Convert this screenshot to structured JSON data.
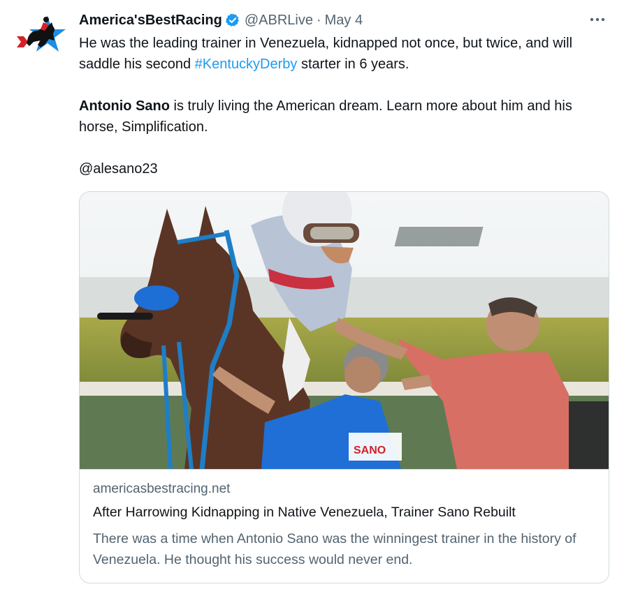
{
  "tweet": {
    "author": {
      "display_name": "America'sBestRacing",
      "handle": "@ABRLive",
      "separator": "·",
      "date": "May 4",
      "verified": true,
      "avatar_icon": "jockey-on-star-logo"
    },
    "more_icon": "more-horizontal-icon",
    "text": {
      "line1_prefix": "He was the leading trainer in Venezuela, kidnapped not once, but twice, and will saddle his second ",
      "hashtag": "#KentuckyDerby",
      "line1_suffix": " starter in 6 years.",
      "p2_bold": "Antonio Sano",
      "p2_rest": " is truly living the American dream. Learn more about him and his horse, Simplification.",
      "mention": "@alesano23"
    },
    "card": {
      "domain": "americasbestracing.net",
      "title": "After Harrowing Kidnapping in Native Venezuela, Trainer Sano Rebuilt",
      "description": "There was a time when Antonio Sano was the winningest trainer in the history of Venezuela. He thought his success would never end.",
      "image_subject": "jockey-on-horse-with-trainers-photo",
      "shirt_logo": "SANO"
    }
  },
  "colors": {
    "text": "#0f1419",
    "secondary": "#536471",
    "link": "#1d9bf0",
    "border": "#cfd9de",
    "verified": "#1d9bf0"
  }
}
